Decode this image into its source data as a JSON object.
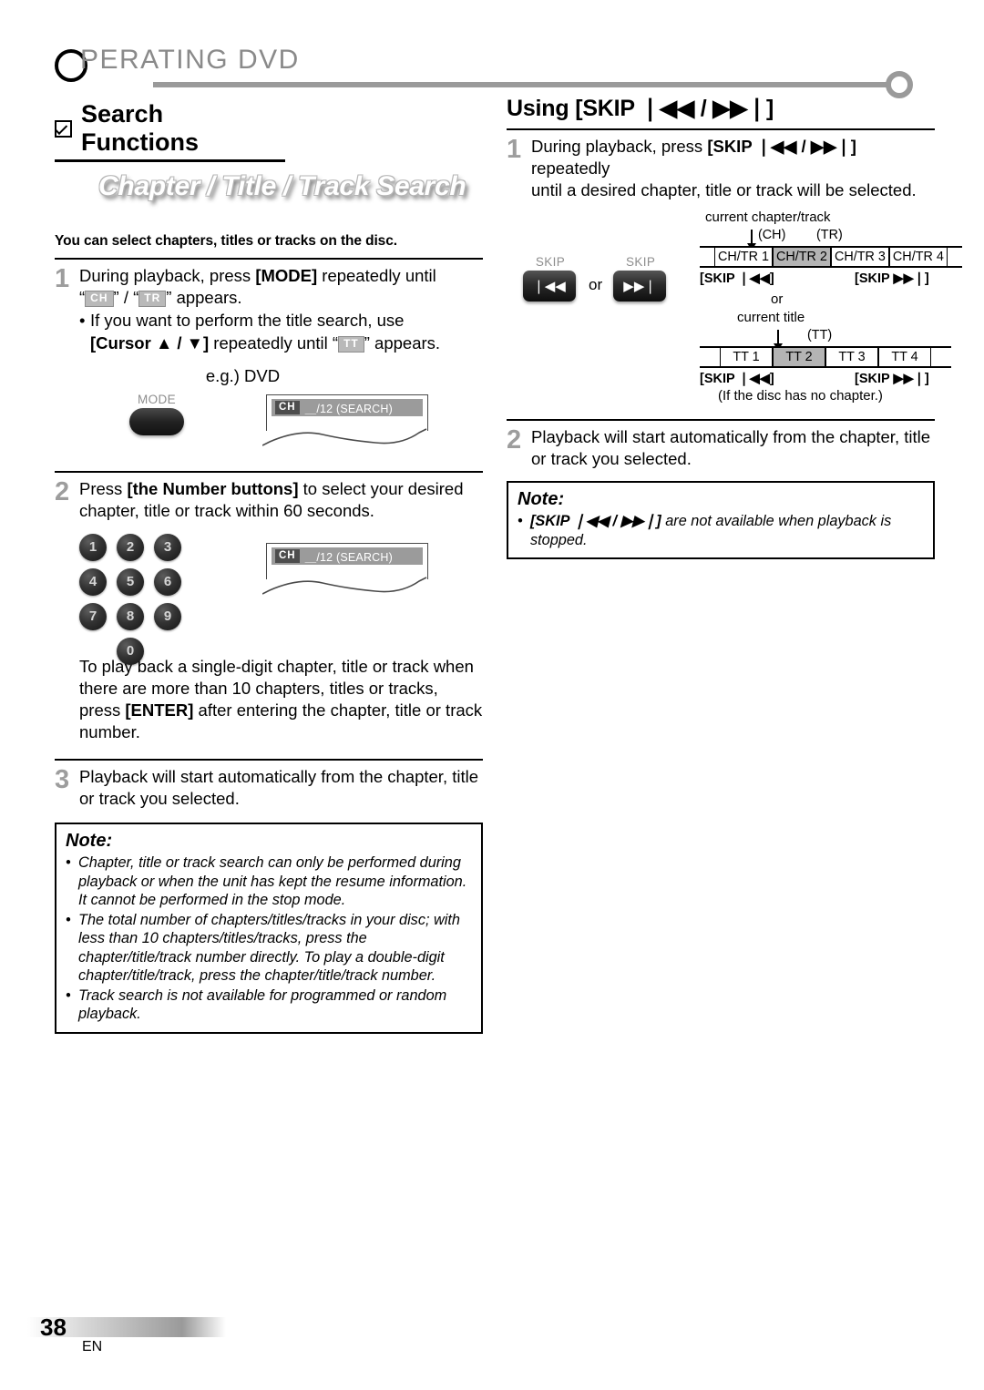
{
  "running_head": {
    "title": "OPERATING  DVD",
    "drop_cap": "O",
    "rest": "PERATING  DVD"
  },
  "left": {
    "section_title": "Search Functions",
    "banner": "Chapter / Title / Track Search",
    "lede": "You can select chapters, titles or tracks on the disc.",
    "steps": [
      {
        "num": "1",
        "line1_a": "During playback, press ",
        "line1_b": "[MODE]",
        "line1_c": " repeatedly until",
        "line2_open": "“",
        "chip1": "CH",
        "line2_mid": "” / “",
        "chip2": "TR",
        "line2_end": "” appears.",
        "sub_a": "If you want to perform the title search, use",
        "sub_b": "[Cursor ▲ / ▼]",
        "sub_c": " repeatedly until “",
        "chip3": "TT",
        "sub_d": "” appears.",
        "eg": "e.g.) DVD"
      },
      {
        "num": "2",
        "line_a": "Press ",
        "line_b": "[the Number buttons]",
        "line_c": " to select your desired",
        "line2": "chapter, title or track within 60 seconds.",
        "after_a": "To play back a single-digit chapter, title or track when there are more than 10 chapters, titles or tracks, press ",
        "after_b": "[ENTER]",
        "after_c": " after entering the chapter, title or track number."
      },
      {
        "num": "3",
        "line1": "Playback will start automatically from the chapter, title",
        "line2": "or track you selected."
      }
    ],
    "mode_button": {
      "label": "MODE"
    },
    "display": {
      "chip": "CH",
      "text": "＿/12 (SEARCH)"
    },
    "numpad": [
      "1",
      "2",
      "3",
      "4",
      "5",
      "6",
      "7",
      "8",
      "9",
      "0"
    ],
    "note": {
      "header": "Note:",
      "items": [
        "Chapter, title or track search can only be performed during playback or when the unit has kept the resume information. It cannot be performed in the stop mode.",
        "The total number of chapters/titles/tracks in your disc; with less than 10 chapters/titles/tracks, press the chapter/title/track number directly. To play a double-digit chapter/title/track, press the chapter/title/track number.",
        "Track search is not available for programmed or random playback."
      ]
    }
  },
  "right": {
    "heading": "Using [SKIP ⏮⏮ / ⏭⏭]",
    "heading_prefix": "Using [SKIP ",
    "heading_sep": " / ",
    "heading_suffix": "]",
    "skip_back_glyph": "❘◀◀",
    "skip_fwd_glyph": "▶▶❘",
    "steps": [
      {
        "num": "1",
        "line_a": "During playback, press ",
        "line_b": "[SKIP ❘◀◀ / ▶▶❘]",
        "line_c": " repeatedly",
        "line2": "until a desired chapter, title or track will be selected."
      },
      {
        "num": "2",
        "line1": "Playback will start automatically from the chapter, title",
        "line2": "or track you selected."
      }
    ],
    "diagram": {
      "skip_label": "SKIP",
      "or_label": "or",
      "caption_top": "current chapter/track",
      "caption_ch": "(CH)",
      "caption_tr": "(TR)",
      "caption_or": "or",
      "caption_title": "current title",
      "caption_tt": "(TT)",
      "row_chtr": [
        "CH/TR 1",
        "CH/TR 2",
        "CH/TR 3",
        "CH/TR 4"
      ],
      "row_chtr_highlight_index": 1,
      "row_tt": [
        "TT 1",
        "TT 2",
        "TT 3",
        "TT 4"
      ],
      "row_tt_highlight_index": 1,
      "key_back": "[SKIP ❘◀◀]",
      "key_fwd": "[SKIP ▶▶❘]",
      "footnote": "(If the disc has no chapter.)"
    },
    "note": {
      "header": "Note:",
      "item_a": "[SKIP ❘◀◀ / ▶▶❘]",
      "item_b": " are not available when playback is stopped."
    }
  },
  "footer": {
    "page": "38",
    "lang": "EN"
  },
  "colors": {
    "accent_gray": "#9a9a9a",
    "highlight": "#b4b4b4",
    "chip_bg": "#b9b9b9"
  }
}
